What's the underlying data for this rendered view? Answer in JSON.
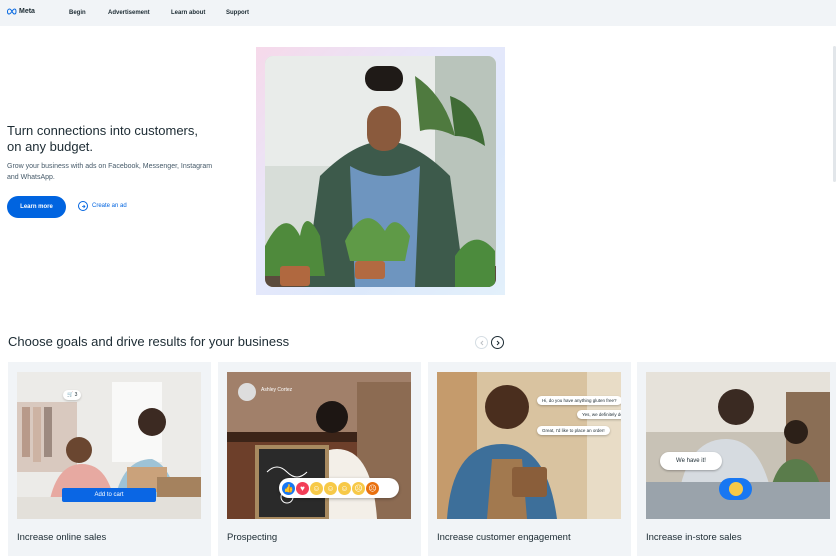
{
  "nav": {
    "logo_text": "Meta",
    "items": [
      {
        "label": "Begin"
      },
      {
        "label": "Advertisement"
      },
      {
        "label": "Learn about"
      },
      {
        "label": "Support"
      }
    ]
  },
  "hero": {
    "title": "Turn connections into customers, on any budget.",
    "description": "Grow your business with ads on Facebook, Messenger, Instagram and WhatsApp.",
    "primary_button": "Learn more",
    "secondary_link": "Create an ad"
  },
  "goals": {
    "title": "Choose goals and drive results for your business",
    "cards": [
      {
        "label": "Increase online sales",
        "badge": "3",
        "button": "Add to cart"
      },
      {
        "label": "Prospecting",
        "profile_name": "Ashley Cortez"
      },
      {
        "label": "Increase customer engagement",
        "chat": [
          "Hi, do you have anything gluten free?",
          "Yes, we definitely do!",
          "Great, I'd like to place an order!"
        ]
      },
      {
        "label": "Increase in-store sales",
        "chat": "We have it!"
      }
    ]
  },
  "colors": {
    "accent": "#0064e0",
    "nav_bg": "#f1f4f7",
    "text": "#1c2b33"
  }
}
